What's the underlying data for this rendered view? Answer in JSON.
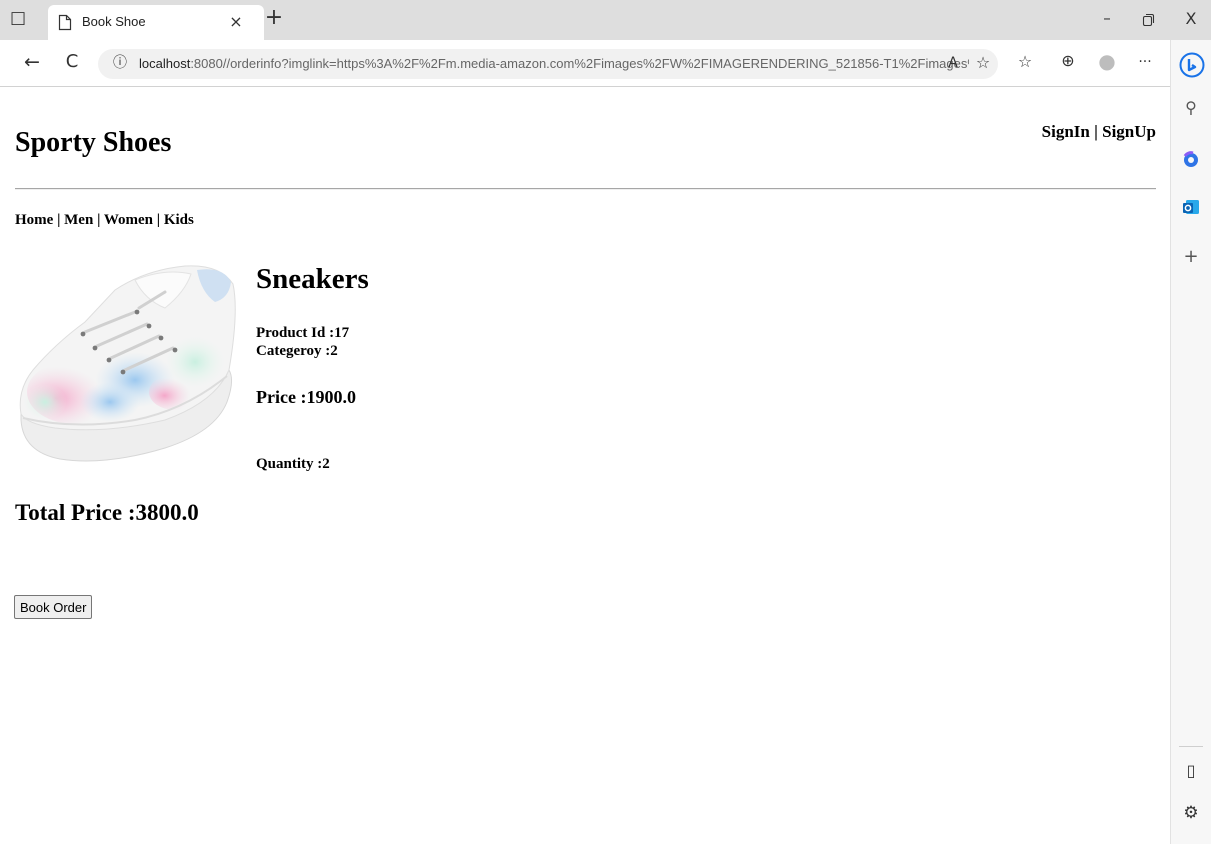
{
  "browser": {
    "tab_title": "Book Shoe",
    "url_host": "localhost",
    "url_path": ":8080//orderinfo?imglink=https%3A%2F%2Fm.media-amazon.com%2Fimages%2FW%2FIMAGERENDERING_521856-T1%2Fimages%2FI...",
    "icons": {
      "tab_actions": "□",
      "page": "🗋",
      "close_tab": "×",
      "new_tab": "+",
      "minimize": "–",
      "restore": "🗗",
      "close_window": "X",
      "back": "←",
      "refresh": "C",
      "info": "ⓘ",
      "read_aloud": "A",
      "add_favorite": "☆",
      "favorites": "☆",
      "collections": "⊕",
      "profile": "●",
      "more": "···",
      "search": "⚲",
      "add": "+",
      "sidebar": "▯",
      "settings": "⚙"
    }
  },
  "site": {
    "title": "Sporty Shoes",
    "auth": {
      "signin": "SignIn",
      "separator": " | ",
      "signup": "SignUp"
    },
    "nav": [
      "Home",
      "Men",
      "Women",
      "Kids"
    ],
    "nav_separator": " | "
  },
  "product": {
    "name": "Sneakers",
    "product_id_label": "Product Id :",
    "product_id": "17",
    "category_label": "Categeroy :",
    "category": "2",
    "price_label": "Price :",
    "price": "1900.0",
    "quantity_label": "Quantity :",
    "quantity": "2"
  },
  "order": {
    "total_label": "Total Price :",
    "total": "3800.0",
    "book_button": "Book Order"
  },
  "colors": {
    "tabbar": "#dedede",
    "bing_blue": "#1a73e8"
  }
}
